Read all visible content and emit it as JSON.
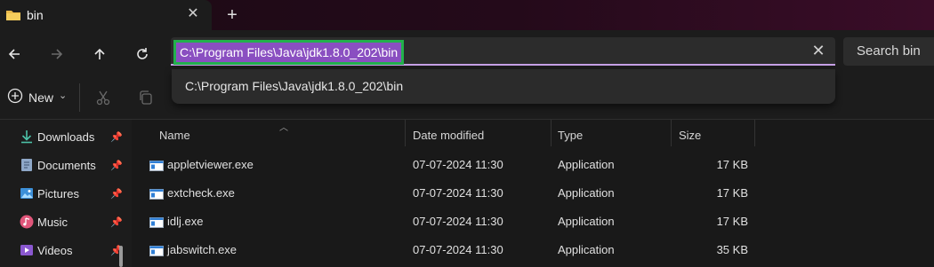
{
  "window": {
    "tab_title": "bin",
    "tab_close": "✕",
    "new_tab": "+"
  },
  "address_bar": {
    "path": "C:\\Program Files\\Java\\jdk1.8.0_202\\bin",
    "clear": "✕",
    "search_placeholder": "Search bin",
    "suggestion": "C:\\Program Files\\Java\\jdk1.8.0_202\\bin"
  },
  "toolbar": {
    "new_label": "New",
    "new_chevron": "⌄"
  },
  "sidebar": {
    "items": [
      {
        "label": "Downloads",
        "pin": "📌"
      },
      {
        "label": "Documents",
        "pin": "📌"
      },
      {
        "label": "Pictures",
        "pin": "📌"
      },
      {
        "label": "Music",
        "pin": "📌"
      },
      {
        "label": "Videos",
        "pin": "📌"
      }
    ]
  },
  "columns": {
    "name": "Name",
    "date": "Date modified",
    "type": "Type",
    "size": "Size",
    "sort_glyph": "︿"
  },
  "files": [
    {
      "name": "appletviewer.exe",
      "date": "07-07-2024 11:30",
      "type": "Application",
      "size": "17 KB"
    },
    {
      "name": "extcheck.exe",
      "date": "07-07-2024 11:30",
      "type": "Application",
      "size": "17 KB"
    },
    {
      "name": "idlj.exe",
      "date": "07-07-2024 11:30",
      "type": "Application",
      "size": "17 KB"
    },
    {
      "name": "jabswitch.exe",
      "date": "07-07-2024 11:30",
      "type": "Application",
      "size": "35 KB"
    }
  ],
  "colors": {
    "selection": "#8a4fc1",
    "highlight_box": "#22b14c",
    "accent_line": "#c6a0e6"
  }
}
